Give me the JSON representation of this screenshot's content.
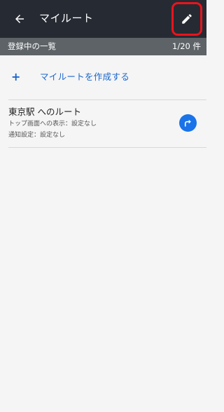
{
  "appbar": {
    "title": "マイルート",
    "back_icon": "arrow-left-icon",
    "edit_icon": "pencil-icon",
    "highlight_color": "#e8141c"
  },
  "subheader": {
    "label": "登録中の一覧",
    "count": "1/20 件"
  },
  "create": {
    "plus": "+",
    "label": "マイルートを作成する"
  },
  "routes": [
    {
      "name": "東京駅 へのルート",
      "top_display": "トップ画面への表示：設定なし",
      "notification": "通知設定：設定なし",
      "action_icon": "turn-right-icon"
    }
  ],
  "colors": {
    "appbar_bg": "#262a33",
    "subheader_bg": "#5d6367",
    "accent": "#1a66cc",
    "route_button": "#1a73e8"
  }
}
